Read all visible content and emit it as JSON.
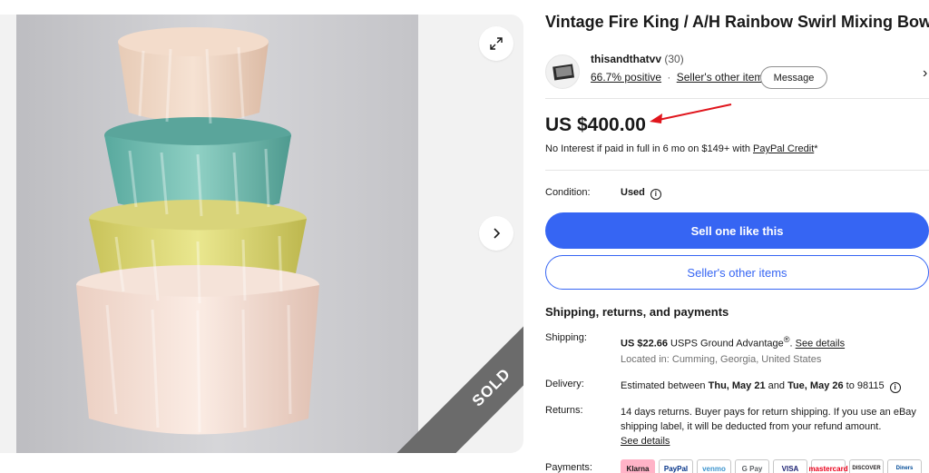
{
  "listing": {
    "title": "Vintage Fire King / A/H Rainbow Swirl Mixing Bowl",
    "sold_label": "SOLD"
  },
  "seller": {
    "name": "thisandthatvv",
    "count": "(30)",
    "positive": "66.7% positive",
    "separator": "·",
    "other_items": "Seller's other items",
    "message": "Message"
  },
  "price": {
    "amount": "US $400.00",
    "credit_prefix": "No Interest if paid in full in 6 mo on $149+ with ",
    "credit_link": "PayPal Credit",
    "credit_suffix": "*"
  },
  "condition": {
    "label": "Condition:",
    "value": "Used",
    "info": "i"
  },
  "actions": {
    "sell_one": "Sell one like this",
    "seller_items": "Seller's other items"
  },
  "shipping": {
    "heading": "Shipping, returns, and payments",
    "shipping_label": "Shipping:",
    "shipping_cost": "US $22.66",
    "shipping_service": " USPS Ground Advantage",
    "shipping_reg": "®",
    "shipping_dot": ". ",
    "shipping_link": "See details",
    "location": "Located in: Cumming, Georgia, United States",
    "delivery_label": "Delivery:",
    "delivery_prefix": "Estimated between ",
    "delivery_start": "Thu, May 21",
    "delivery_and": " and ",
    "delivery_end": "Tue, May 26",
    "delivery_suffix": " to 98115",
    "returns_label": "Returns:",
    "returns_text": "14 days returns. Buyer pays for return shipping. If you use an eBay shipping label, it will be deducted from your refund amount.",
    "returns_link": "See details",
    "payments_label": "Payments:"
  },
  "payment_methods": [
    "Klarna",
    "PayPal",
    "venmo",
    "G Pay",
    "VISA",
    "mastercard",
    "DISCOVER",
    "Diners"
  ],
  "icons": {
    "expand": "expand-icon",
    "next": "chevron-right-icon",
    "info": "info-icon"
  },
  "colors": {
    "primary": "#3665f3",
    "arrow": "#e0151c"
  }
}
